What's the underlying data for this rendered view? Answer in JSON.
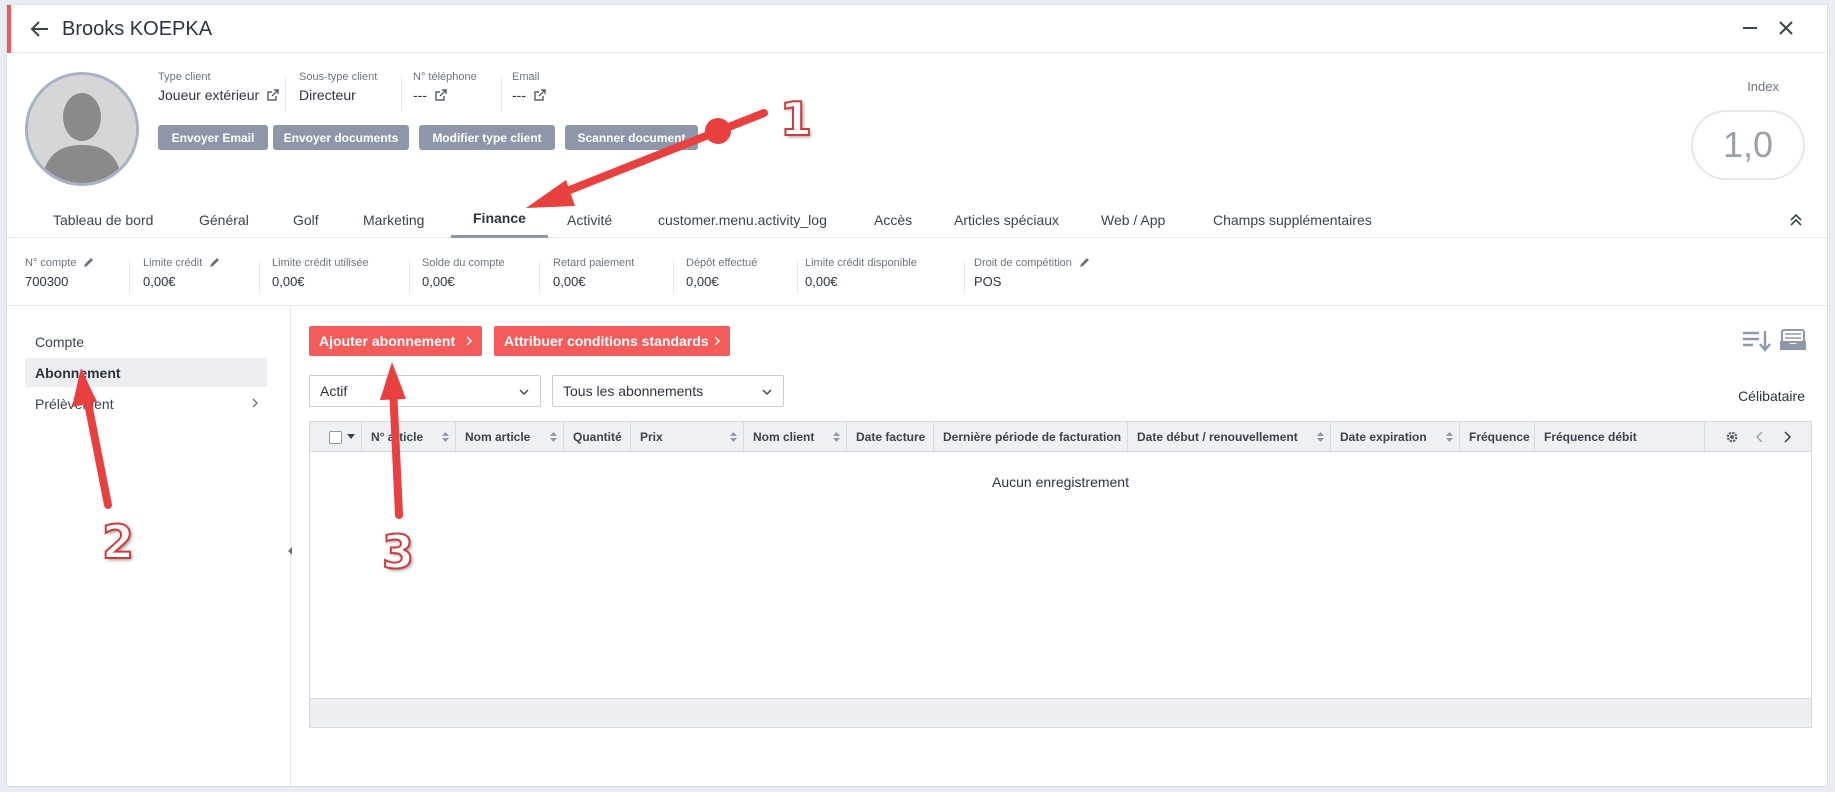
{
  "window": {
    "title": "Brooks KOEPKA"
  },
  "header": {
    "fields": [
      {
        "label": "Type client",
        "value": "Joueur extérieur"
      },
      {
        "label": "Sous-type client",
        "value": "Directeur"
      },
      {
        "label": "N° téléphone",
        "value": "---"
      },
      {
        "label": "Email",
        "value": "---"
      }
    ],
    "buttons": [
      "Envoyer Email",
      "Envoyer documents",
      "Modifier type client",
      "Scanner document"
    ],
    "index_label": "Index",
    "index_value": "1,0"
  },
  "tabs": [
    {
      "label": "Tableau de bord"
    },
    {
      "label": "Général"
    },
    {
      "label": "Golf"
    },
    {
      "label": "Marketing"
    },
    {
      "label": "Finance",
      "active": true
    },
    {
      "label": "Activité"
    },
    {
      "label": "customer.menu.activity_log"
    },
    {
      "label": "Accès"
    },
    {
      "label": "Articles spéciaux"
    },
    {
      "label": "Web / App"
    },
    {
      "label": "Champs supplémentaires"
    }
  ],
  "stats": [
    {
      "label": "N° compte",
      "value": "700300",
      "editable": true
    },
    {
      "label": "Limite crédit",
      "value": "0,00€",
      "editable": true
    },
    {
      "label": "Limite crédit utilisée",
      "value": "0,00€"
    },
    {
      "label": "Solde du compte",
      "value": "0,00€"
    },
    {
      "label": "Retard paiement",
      "value": "0,00€"
    },
    {
      "label": "Dépôt effectué",
      "value": "0,00€"
    },
    {
      "label": "Limite crédit disponible",
      "value": "0,00€"
    },
    {
      "label": "Droit de compétition",
      "value": "POS",
      "editable": true
    }
  ],
  "sidebar": {
    "items": [
      {
        "label": "Compte"
      },
      {
        "label": "Abonnement",
        "active": true
      },
      {
        "label": "Prélèvement"
      }
    ]
  },
  "actions": {
    "add_subscription": "Ajouter abonnement",
    "assign_conditions": "Attribuer conditions standards"
  },
  "filters": {
    "status": "Actif",
    "subscriptions": "Tous les abonnements"
  },
  "marital_status": "Célibataire",
  "grid": {
    "columns": [
      "N° article",
      "Nom article",
      "Quantité",
      "Prix",
      "Nom client",
      "Date facture",
      "Dernière période de facturation",
      "Date début / renouvellement",
      "Date expiration",
      "Fréquence",
      "Fréquence débit"
    ],
    "empty_text": "Aucun enregistrement"
  },
  "annotations": [
    "1",
    "2",
    "3"
  ],
  "colors": {
    "accent": "#f45b5b",
    "grey_button": "#8e97aa",
    "annotation_arrow": "#e8403f"
  }
}
